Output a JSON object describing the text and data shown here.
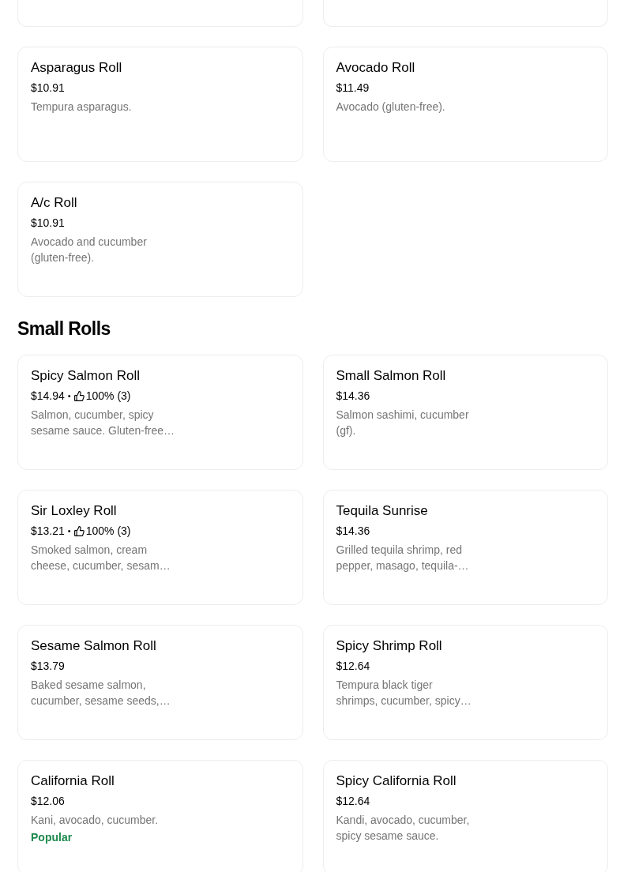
{
  "sections": [
    {
      "items": [
        {
          "kind": "cut"
        },
        {
          "kind": "cut"
        },
        {
          "kind": "dish",
          "name": "Asparagus Roll",
          "price": "$10.91",
          "description": "Tempura asparagus."
        },
        {
          "kind": "dish",
          "name": "Avocado Roll",
          "price": "$11.49",
          "description": "Avocado (gluten-free)."
        },
        {
          "kind": "dish",
          "name": "A/c Roll",
          "price": "$10.91",
          "description": "Avocado and cucumber\n(gluten-free)."
        }
      ]
    },
    {
      "title": "Small Rolls",
      "items": [
        {
          "kind": "dish",
          "name": "Spicy Salmon Roll",
          "price": "$14.94",
          "rating": {
            "separator": "•",
            "score": "100% (3)"
          },
          "description": "Salmon, cucumber, spicy\nsesame sauce. Gluten-free…"
        },
        {
          "kind": "dish",
          "name": "Small Salmon Roll",
          "price": "$14.36",
          "description": "Salmon sashimi, cucumber\n(gf)."
        },
        {
          "kind": "dish",
          "name": "Sir Loxley Roll",
          "price": "$13.21",
          "rating": {
            "separator": "•",
            "score": "100% (3)"
          },
          "description": "Smoked salmon, cream\ncheese, cucumber, sesam…"
        },
        {
          "kind": "dish",
          "name": "Tequila Sunrise",
          "price": "$14.36",
          "description": "Grilled tequila shrimp, red\npepper, masago, tequila-…"
        },
        {
          "kind": "dish",
          "name": "Sesame Salmon Roll",
          "price": "$13.79",
          "description": "Baked sesame salmon,\ncucumber, sesame seeds,…"
        },
        {
          "kind": "dish",
          "name": "Spicy Shrimp Roll",
          "price": "$12.64",
          "description": "Tempura black tiger\nshrimps, cucumber, spicy…"
        },
        {
          "kind": "dish",
          "name": "California Roll",
          "price": "$12.06",
          "description": "Kani, avocado, cucumber.",
          "badge": "Popular"
        },
        {
          "kind": "dish",
          "name": "Spicy California Roll",
          "price": "$12.64",
          "description": "Kandi, avocado, cucumber,\nspicy sesame sauce."
        }
      ]
    }
  ]
}
